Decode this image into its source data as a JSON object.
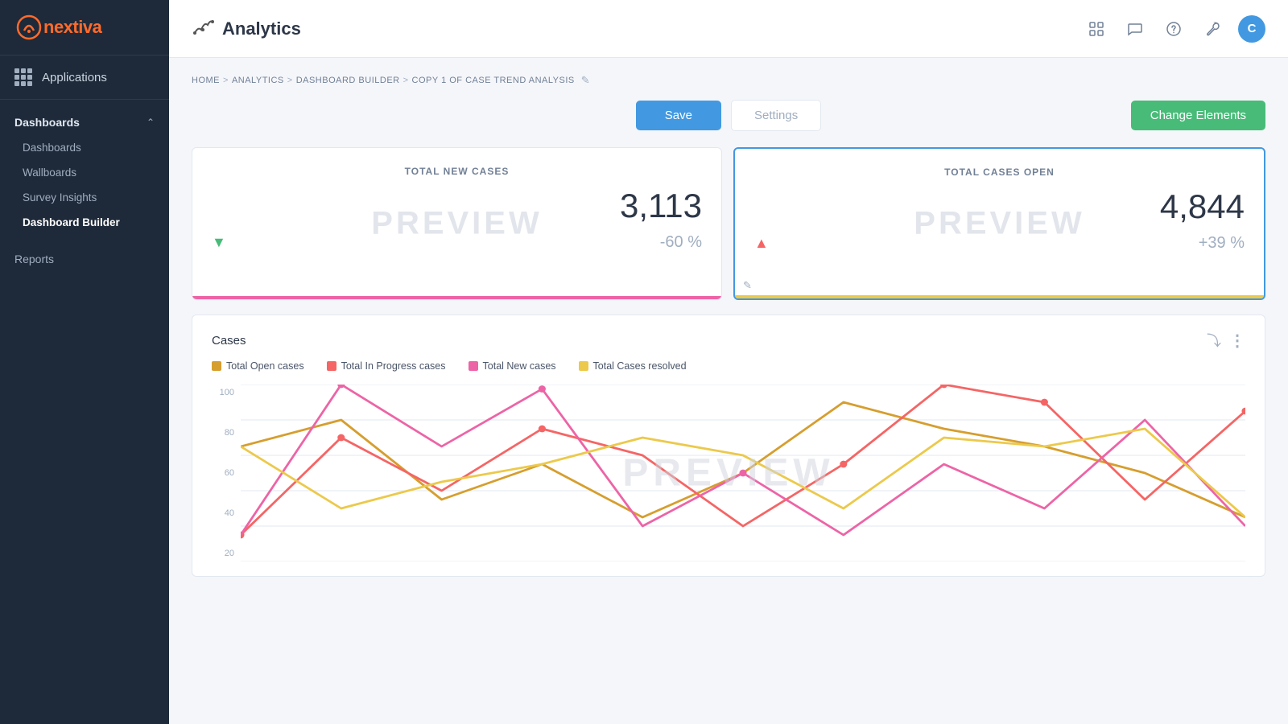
{
  "sidebar": {
    "logo": "nextiva",
    "apps_label": "Applications",
    "dashboards_section": "Dashboards",
    "nav_items": [
      {
        "label": "Dashboards",
        "active": false
      },
      {
        "label": "Wallboards",
        "active": false
      },
      {
        "label": "Survey Insights",
        "active": false
      },
      {
        "label": "Dashboard Builder",
        "active": true
      }
    ],
    "reports_label": "Reports"
  },
  "header": {
    "page_title": "Analytics",
    "topbar_icons": [
      "grid-icon",
      "chat-icon",
      "help-icon",
      "wrench-icon"
    ],
    "avatar_letter": "C"
  },
  "breadcrumb": {
    "home": "HOME",
    "analytics": "ANALYTICS",
    "dashboard_builder": "DASHBOARD BUILDER",
    "current": "COPY 1 OF CASE TREND ANALYSIS"
  },
  "actions": {
    "save_label": "Save",
    "settings_label": "Settings",
    "change_elements_label": "Change Elements"
  },
  "cards": [
    {
      "title": "TOTAL NEW CASES",
      "preview": "PREVIEW",
      "value": "3,113",
      "pct": "-60 %",
      "trend": "down",
      "bar_color": "pink"
    },
    {
      "title": "TOTAL CASES OPEN",
      "preview": "PREVIEW",
      "value": "4,844",
      "pct": "+39 %",
      "trend": "up",
      "bar_color": "yellow"
    }
  ],
  "chart": {
    "title": "Cases",
    "preview": "PREVIEW",
    "legend": [
      {
        "label": "Total Open cases",
        "color": "#d69e2e"
      },
      {
        "label": "Total In Progress cases",
        "color": "#f56565"
      },
      {
        "label": "Total New cases",
        "color": "#ed64a6"
      },
      {
        "label": "Total Cases resolved",
        "color": "#ecc94b"
      }
    ],
    "y_labels": [
      "100",
      "80",
      "60",
      "40",
      "20"
    ],
    "colors": {
      "open": "#d69e2e",
      "in_progress": "#f56565",
      "new": "#ed64a6",
      "resolved": "#ecc94b"
    }
  }
}
